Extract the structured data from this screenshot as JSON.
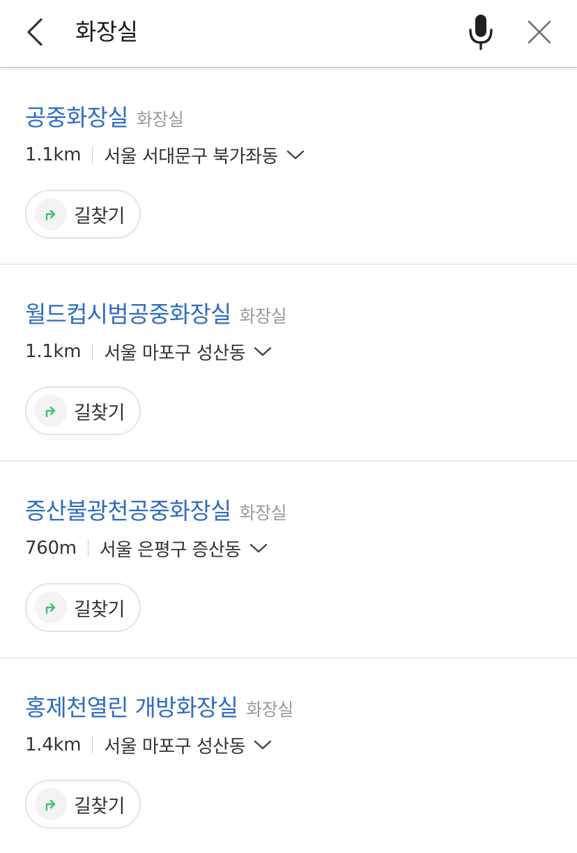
{
  "search": {
    "query": "화장실"
  },
  "icons": {
    "back": "chevron-left-icon",
    "mic": "microphone-icon",
    "close": "close-icon",
    "expand": "chevron-down-icon",
    "route": "route-turn-arrow-icon"
  },
  "colors": {
    "place_name": "#2f6cc0",
    "route_arrow": "#3cc36c",
    "category": "#9a9a9a"
  },
  "results": [
    {
      "name": "공중화장실",
      "category": "화장실",
      "distance": "1.1km",
      "address": "서울 서대문구 북가좌동",
      "route_label": "길찾기"
    },
    {
      "name": "월드컵시범공중화장실",
      "category": "화장실",
      "distance": "1.1km",
      "address": "서울 마포구 성산동",
      "route_label": "길찾기"
    },
    {
      "name": "증산불광천공중화장실",
      "category": "화장실",
      "distance": "760m",
      "address": "서울 은평구 증산동",
      "route_label": "길찾기"
    },
    {
      "name": "홍제천열린 개방화장실",
      "category": "화장실",
      "distance": "1.4km",
      "address": "서울 마포구 성산동",
      "route_label": "길찾기"
    }
  ]
}
